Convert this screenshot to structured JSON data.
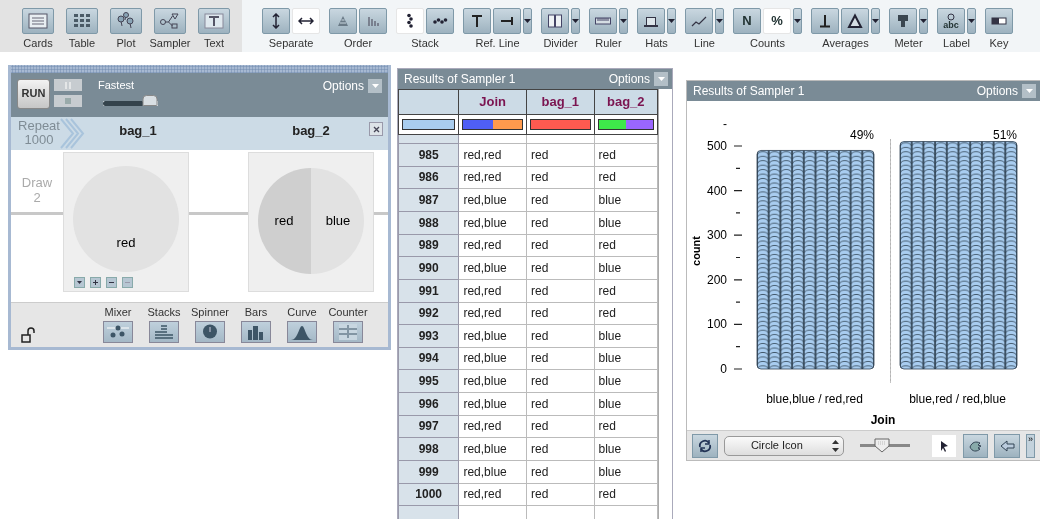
{
  "toolbar": {
    "objects": [
      {
        "label": "Cards"
      },
      {
        "label": "Table"
      },
      {
        "label": "Plot"
      },
      {
        "label": "Sampler"
      },
      {
        "label": "Text"
      }
    ],
    "groups": [
      {
        "label": "Separate",
        "buttons": [
          {
            "selected": false
          },
          {
            "selected": true
          }
        ]
      },
      {
        "label": "Order",
        "buttons": [
          {
            "selected": false
          },
          {
            "selected": false
          }
        ]
      },
      {
        "label": "Stack",
        "buttons": [
          {
            "selected": true
          },
          {
            "selected": false
          }
        ]
      },
      {
        "label": "Ref. Line",
        "buttons": [
          {
            "selected": false
          },
          {
            "selected": false
          }
        ],
        "has_menu": true
      },
      {
        "label": "Divider",
        "buttons": [
          {
            "selected": false
          }
        ],
        "has_menu": true
      },
      {
        "label": "Ruler",
        "buttons": [
          {
            "selected": false
          }
        ],
        "has_menu": true
      },
      {
        "label": "Hats",
        "buttons": [
          {
            "selected": false
          }
        ],
        "has_menu": true
      },
      {
        "label": "Line",
        "buttons": [
          {
            "selected": false
          }
        ],
        "has_menu": true
      },
      {
        "label": "Counts",
        "buttons": [
          {
            "text": "N",
            "selected": false
          },
          {
            "text": "%",
            "selected": true
          }
        ],
        "has_menu": true
      },
      {
        "label": "Averages",
        "buttons": [
          {
            "selected": false
          },
          {
            "selected": false
          }
        ],
        "has_menu": true
      },
      {
        "label": "Meter",
        "buttons": [
          {
            "selected": false
          }
        ],
        "has_menu": true
      },
      {
        "label": "Label",
        "buttons": [
          {
            "text": "abc",
            "selected": false
          }
        ],
        "has_menu": true
      },
      {
        "label": "Key",
        "buttons": [
          {
            "selected": false
          }
        ]
      }
    ]
  },
  "sampler": {
    "run_label": "RUN",
    "speed": {
      "label": "Fastest",
      "level": 0.75
    },
    "options_label": "Options",
    "repeat": {
      "label": "Repeat",
      "value": "1000"
    },
    "draw": {
      "label": "Draw",
      "value": "2"
    },
    "devices": [
      {
        "name": "bag_1",
        "kind": "mixer",
        "items": [
          {
            "label": "red"
          }
        ]
      },
      {
        "name": "bag_2",
        "kind": "spinner",
        "items": [
          {
            "label": "red"
          },
          {
            "label": "blue"
          }
        ]
      }
    ],
    "palette": [
      {
        "label": "Mixer"
      },
      {
        "label": "Stacks"
      },
      {
        "label": "Spinner"
      },
      {
        "label": "Bars"
      },
      {
        "label": "Curve"
      },
      {
        "label": "Counter"
      }
    ]
  },
  "table": {
    "title": "Results of Sampler 1",
    "options_label": "Options",
    "index_swatch": {
      "color": "#a9cdee"
    },
    "columns": [
      {
        "label": "Join",
        "swatches": [
          {
            "color": "#4f5ff5"
          },
          {
            "color": "#ff9a4d"
          }
        ]
      },
      {
        "label": "bag_1",
        "swatches": [
          {
            "color": "#ff5a50"
          }
        ]
      },
      {
        "label": "bag_2",
        "swatches": [
          {
            "color": "#3ee84a"
          },
          {
            "color": "#9a66ff"
          }
        ]
      }
    ],
    "rows": [
      {
        "index": "985",
        "cells": [
          "red,red",
          "red",
          "red"
        ]
      },
      {
        "index": "986",
        "cells": [
          "red,red",
          "red",
          "red"
        ]
      },
      {
        "index": "987",
        "cells": [
          "red,blue",
          "red",
          "blue"
        ]
      },
      {
        "index": "988",
        "cells": [
          "red,blue",
          "red",
          "blue"
        ]
      },
      {
        "index": "989",
        "cells": [
          "red,red",
          "red",
          "red"
        ]
      },
      {
        "index": "990",
        "cells": [
          "red,blue",
          "red",
          "blue"
        ]
      },
      {
        "index": "991",
        "cells": [
          "red,red",
          "red",
          "red"
        ]
      },
      {
        "index": "992",
        "cells": [
          "red,red",
          "red",
          "red"
        ]
      },
      {
        "index": "993",
        "cells": [
          "red,blue",
          "red",
          "blue"
        ]
      },
      {
        "index": "994",
        "cells": [
          "red,blue",
          "red",
          "blue"
        ]
      },
      {
        "index": "995",
        "cells": [
          "red,blue",
          "red",
          "blue"
        ]
      },
      {
        "index": "996",
        "cells": [
          "red,blue",
          "red",
          "blue"
        ]
      },
      {
        "index": "997",
        "cells": [
          "red,red",
          "red",
          "red"
        ]
      },
      {
        "index": "998",
        "cells": [
          "red,blue",
          "red",
          "blue"
        ]
      },
      {
        "index": "999",
        "cells": [
          "red,blue",
          "red",
          "blue"
        ]
      },
      {
        "index": "1000",
        "cells": [
          "red,red",
          "red",
          "red"
        ]
      }
    ]
  },
  "plot": {
    "title": "Results of Sampler 1",
    "options_label": "Options",
    "chart_data": {
      "type": "bar",
      "xlabel": "Join",
      "ylabel": "count",
      "categories": [
        "blue,blue / red,red",
        "blue,red / red,blue"
      ],
      "values": [
        490,
        510
      ],
      "ylim": [
        0,
        550
      ],
      "yticks": [
        0,
        100,
        200,
        300,
        400,
        500,
        {
          "value": 550,
          "label": "-"
        }
      ],
      "annotations": [
        "49%",
        "51%"
      ]
    },
    "controls": {
      "icon_select": "Circle Icon",
      "tools": [
        {
          "selected": true
        },
        {
          "selected": false
        },
        {
          "selected": false
        }
      ],
      "more_label": "»"
    }
  }
}
